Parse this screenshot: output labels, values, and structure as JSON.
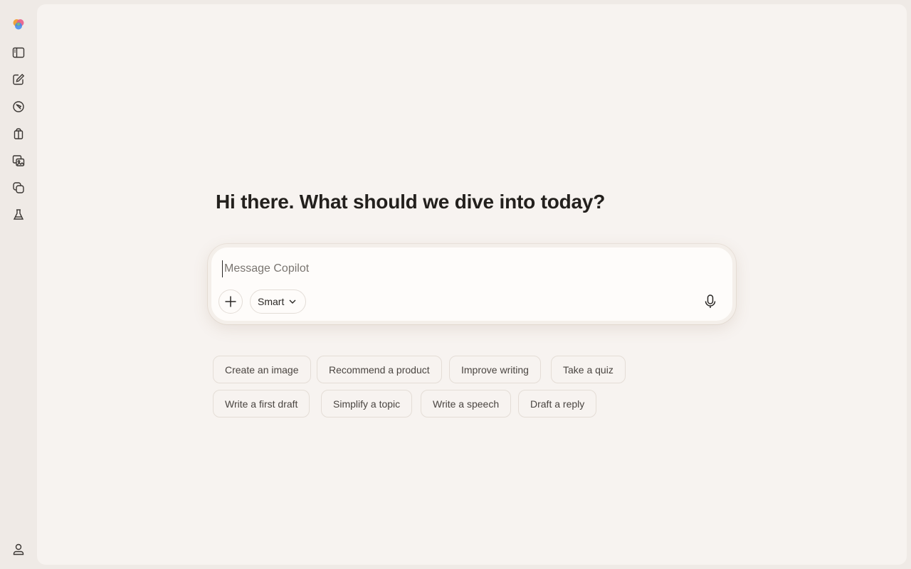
{
  "rail": {
    "items": [
      {
        "icon": "copilot-logo-icon"
      },
      {
        "icon": "sidebar-toggle-icon"
      },
      {
        "icon": "new-chat-icon"
      },
      {
        "icon": "discover-icon"
      },
      {
        "icon": "gift-icon"
      },
      {
        "icon": "image-library-icon"
      },
      {
        "icon": "pages-icon"
      },
      {
        "icon": "labs-icon"
      }
    ],
    "profile_icon": "profile-icon"
  },
  "main": {
    "greeting": "Hi there. What should we dive into today?"
  },
  "composer": {
    "placeholder": "Message Copilot",
    "value": "",
    "mode_label": "Smart",
    "add_icon": "plus-icon",
    "mode_icon": "chevron-down-icon",
    "voice_icon": "microphone-icon"
  },
  "suggestions": [
    [
      "Create an image",
      "Recommend a product",
      "Improve writing",
      "Take a quiz"
    ],
    [
      "Write a first draft",
      "Simplify a topic",
      "Write a speech",
      "Draft a reply"
    ]
  ],
  "colors": {
    "rail_bg": "#efeae6",
    "main_bg": "#f7f3f0",
    "composer_bg": "#fefcfa",
    "text": "#23201d",
    "chip_text": "#4a4541",
    "chip_border": "#e4ddd6"
  }
}
